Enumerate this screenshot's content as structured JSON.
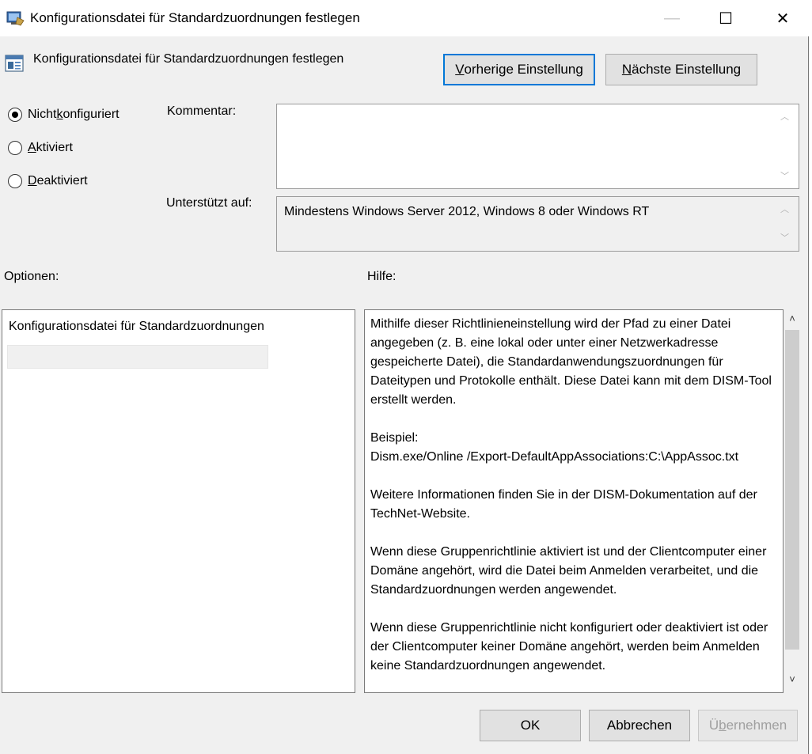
{
  "window": {
    "title": "Konfigurationsdatei für Standardzuordnungen festlegen",
    "controls": {
      "minimize": "—",
      "maximize": "☐",
      "close": "✕"
    }
  },
  "header": {
    "title": "Konfigurationsdatei für Standardzuordnungen festlegen",
    "prev_button": {
      "mnemonic": "V",
      "rest": "orherige Einstellung"
    },
    "next_button": {
      "mnemonic": "N",
      "rest": "ächste Einstellung"
    }
  },
  "state": {
    "options": [
      {
        "pre": "Nicht ",
        "mnemonic": "k",
        "rest": "onfiguriert",
        "selected": true
      },
      {
        "pre": "",
        "mnemonic": "A",
        "rest": "ktiviert",
        "selected": false
      },
      {
        "pre": "",
        "mnemonic": "D",
        "rest": "eaktiviert",
        "selected": false
      }
    ]
  },
  "comment": {
    "label": "Kommentar:",
    "value": ""
  },
  "supported": {
    "label": "Unterstützt auf:",
    "value": "Mindestens Windows Server 2012, Windows 8 oder Windows RT"
  },
  "options_panel": {
    "label": "Optionen:",
    "field_label": "Konfigurationsdatei für Standardzuordnungen",
    "field_value": ""
  },
  "help_panel": {
    "label": "Hilfe:",
    "paragraphs": [
      "Mithilfe dieser Richtlinieneinstellung wird der Pfad zu einer Datei angegeben (z. B. eine lokal oder unter einer Netzwerkadresse gespeicherte Datei), die Standardanwendungszuordnungen für Dateitypen und Protokolle enthält. Diese Datei kann mit dem DISM-Tool erstellt werden.",
      "Beispiel:\nDism.exe/Online /Export-DefaultAppAssociations:C:\\AppAssoc.txt",
      "Weitere Informationen finden Sie in der DISM-Dokumentation auf der TechNet-Website.",
      "Wenn diese Gruppenrichtlinie aktiviert ist und der Clientcomputer einer Domäne angehört, wird die Datei beim Anmelden verarbeitet, und die Standardzuordnungen werden angewendet.",
      "Wenn diese Gruppenrichtlinie nicht konfiguriert oder deaktiviert ist oder der Clientcomputer keiner Domäne angehört, werden beim Anmelden keine Standardzuordnungen angewendet."
    ]
  },
  "footer": {
    "ok": "OK",
    "cancel": "Abbrechen",
    "apply": {
      "pre": "Ü",
      "mnemonic": "b",
      "rest": "ernehmen",
      "enabled": false
    }
  },
  "colors": {
    "accent": "#0078d7",
    "background": "#f0f0f0",
    "disabled_text": "#a0a0a0"
  }
}
